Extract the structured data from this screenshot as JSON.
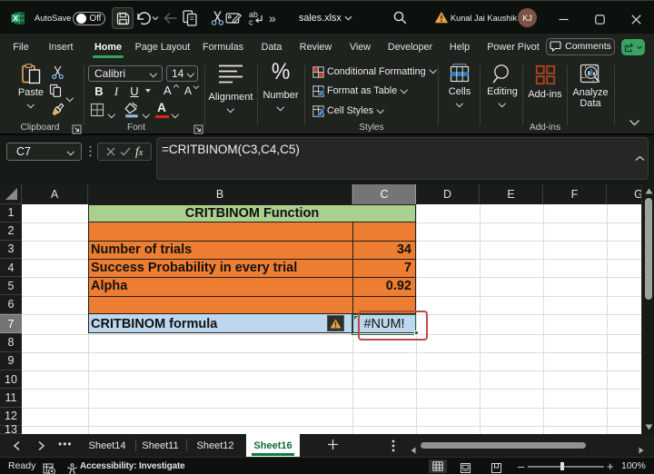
{
  "titlebar": {
    "autosave_label": "AutoSave",
    "autosave_state": "Off",
    "doc_title": "sales.xlsx",
    "user_name": "Kunal Jai Kaushik",
    "user_initials": "KJ",
    "overflow_glyph": "»"
  },
  "ribbon_tabs": [
    "File",
    "Insert",
    "Home",
    "Page Layout",
    "Formulas",
    "Data",
    "Review",
    "View",
    "Developer",
    "Help",
    "Power Pivot"
  ],
  "active_tab": "Home",
  "comments_label": "Comments",
  "ribbon": {
    "paste_label": "Paste",
    "clipboard_group": "Clipboard",
    "font_name": "Calibri",
    "font_size": "14",
    "bold_glyph": "B",
    "italic_glyph": "I",
    "underline_glyph": "U",
    "font_letter_glyph": "A",
    "number_glyph": "%",
    "font_group": "Font",
    "alignment_label": "Alignment",
    "number_label": "Number",
    "styles_items": [
      "Conditional Formatting",
      "Format as Table",
      "Cell Styles"
    ],
    "styles_group": "Styles",
    "cells_label": "Cells",
    "editing_label": "Editing",
    "addins_label": "Add-ins",
    "addins_group": "Add-ins",
    "analyze_line1": "Analyze",
    "analyze_line2": "Data"
  },
  "formula_bar": {
    "name_box": "C7",
    "formula": "=CRITBINOM(C3,C4,C5)"
  },
  "grid": {
    "columns": [
      "A",
      "B",
      "C",
      "D",
      "E",
      "F",
      "G"
    ],
    "selected_column": "C",
    "row_count": 13,
    "selected_row": 7,
    "title_text": "CRITBINOM Function",
    "data_rows": [
      {
        "row": 3,
        "label": "Number of trials",
        "value": "34"
      },
      {
        "row": 4,
        "label": "Success Probability in every trial",
        "value": "7"
      },
      {
        "row": 5,
        "label": "Alpha",
        "value": "0.92"
      }
    ],
    "formula_label": "CRITBINOM formula",
    "result_value": "#NUM!",
    "colors": {
      "title_fill": "#A9D08E",
      "input_fill": "#ED7D31",
      "formula_fill": "#BDD7EE",
      "selection": "#1E7145",
      "annotation": "#BE4A42"
    }
  },
  "sheet_list_glyph": "•••",
  "sheet_tabs": [
    "Sheet14",
    "Sheet11",
    "Sheet12",
    "Sheet16"
  ],
  "active_sheet": "Sheet16",
  "status_bar": {
    "mode": "Ready",
    "accessibility": "Accessibility: Investigate",
    "zoom_out_glyph": "–",
    "zoom_in_glyph": "+",
    "zoom": "100%"
  }
}
